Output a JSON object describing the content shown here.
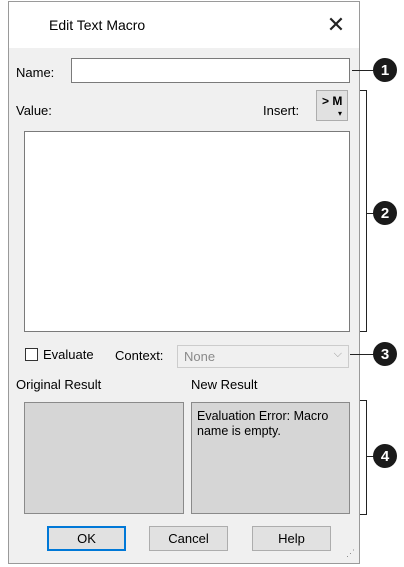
{
  "window": {
    "title": "Edit Text Macro",
    "close_glyph": "✕"
  },
  "name_field": {
    "label": "Name:",
    "value": ""
  },
  "value_section": {
    "label": "Value:",
    "insert_label": "Insert:",
    "insert_button": "> M",
    "insert_arrow": "▾",
    "value_text": ""
  },
  "evaluate": {
    "label": "Evaluate",
    "checked": false
  },
  "context": {
    "label": "Context:",
    "selected": "None",
    "chevron": "⌵"
  },
  "results": {
    "original_label": "Original Result",
    "new_label": "New Result",
    "original_text": "",
    "new_text": "Evaluation Error: Macro name is empty."
  },
  "buttons": {
    "ok": "OK",
    "cancel": "Cancel",
    "help": "Help"
  },
  "callouts": [
    "1",
    "2",
    "3",
    "4"
  ]
}
